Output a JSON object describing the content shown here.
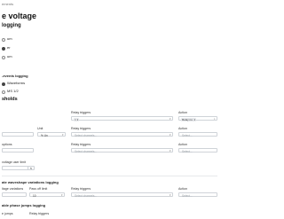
{
  "breadcrumb": "ements",
  "title": "e voltage",
  "logging_section": "logging",
  "radio_options": [
    "um",
    "er",
    "um"
  ],
  "events_section": "-events logging",
  "waveform_opts": [
    "Waveforms",
    "MS 1/2"
  ],
  "thresholds_section": "sholds",
  "col_relay_triggers": "Relay triggers",
  "col_action": "Action",
  "unit_label": "Unit",
  "unit_value": "% Un",
  "select_placeholder": "Select channels...",
  "action_placeholder": "Select...",
  "relay_chip": "Relay no. 1",
  "action_chip": "Relay no. 1",
  "options_label": "options",
  "voltage_user_limit": "voltage user limit",
  "limit_value": "5",
  "waveshape_section": "ate waveshape variations logging",
  "voltage_variations": "ltage variations",
  "pass_off_limit": "Pass off limit",
  "pass_value": "10",
  "pass_unit": "%",
  "phase_section": "able phase jumps logging",
  "phase_jumps": "e jumps",
  "icons": {
    "caret": "▾",
    "close": "×"
  }
}
